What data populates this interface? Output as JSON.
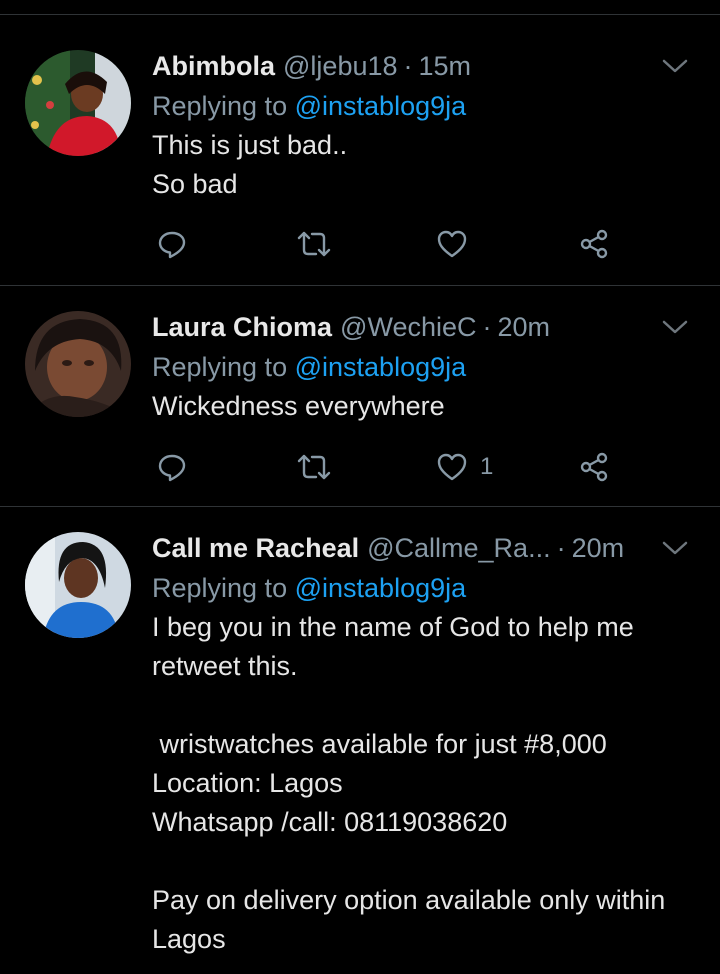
{
  "tweets": [
    {
      "name": "Abimbola",
      "handle": "@ljebu18",
      "sep": "·",
      "time": "15m",
      "replying_prefix": "Replying to",
      "replying_to": "@instablog9ja",
      "text": "This is just bad..\nSo bad",
      "like_count": "",
      "avatar_icon": "profile-photo"
    },
    {
      "name": "Laura Chioma",
      "handle": "@WechieC",
      "sep": "·",
      "time": "20m",
      "replying_prefix": "Replying to",
      "replying_to": "@instablog9ja",
      "text": "Wickedness everywhere",
      "like_count": "1",
      "avatar_icon": "profile-photo"
    },
    {
      "name": "Call me Racheal",
      "handle": "@Callme_Ra...",
      "sep": "·",
      "time": "20m",
      "replying_prefix": "Replying to",
      "replying_to": "@instablog9ja",
      "text": "I beg you in the name of God to help me retweet this.\n\n wristwatches available for just #8,000\nLocation: Lagos\nWhatsapp /call: 08119038620\n\nPay on delivery option available only within Lagos",
      "like_count": "",
      "avatar_icon": "profile-photo"
    }
  ],
  "colors": {
    "background": "#000000",
    "mention": "#1da1f2",
    "muted": "#8899a6",
    "divider": "#2f3336"
  },
  "icons": [
    "reply-icon",
    "retweet-icon",
    "like-icon",
    "share-icon",
    "chevron-down-icon"
  ]
}
